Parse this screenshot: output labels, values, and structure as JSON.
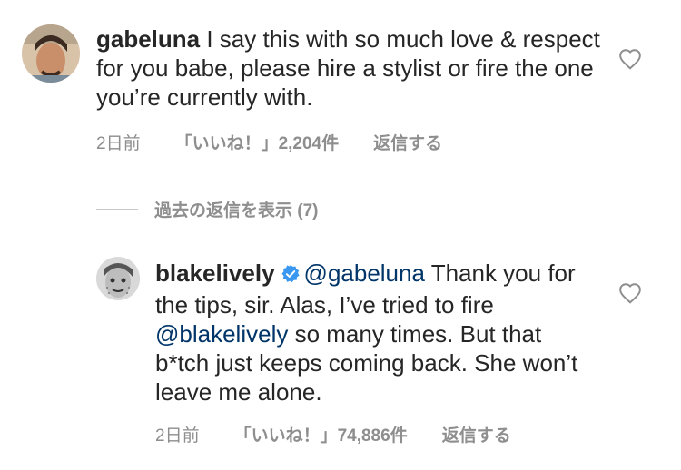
{
  "comment1": {
    "username": "gabeluna",
    "text": " I say this with so much love & respect for you babe, please hire a stylist or fire the one you’re currently with.",
    "time": "2日前",
    "likes": "「いいね！」2,204件",
    "reply_label": "返信する"
  },
  "view_replies": {
    "label": "過去の返信を表示 (7)"
  },
  "reply1": {
    "username": "blakelively",
    "verified": true,
    "mention1": "@gabeluna",
    "text1": " Thank you for the tips, sir. Alas, I’ve tried to fire ",
    "mention2": "@blakelively",
    "text2": " so many times. But that b*tch just keeps coming back. She won’t leave me alone.",
    "time": "2日前",
    "likes": "「いいね！」74,886件",
    "reply_label": "返信する"
  },
  "colors": {
    "text": "#262626",
    "secondary": "#8e8e8e",
    "mention": "#003569",
    "verified": "#3897f0"
  },
  "icons": {
    "heart": "heart-outline-icon",
    "verified": "verified-badge-icon"
  }
}
